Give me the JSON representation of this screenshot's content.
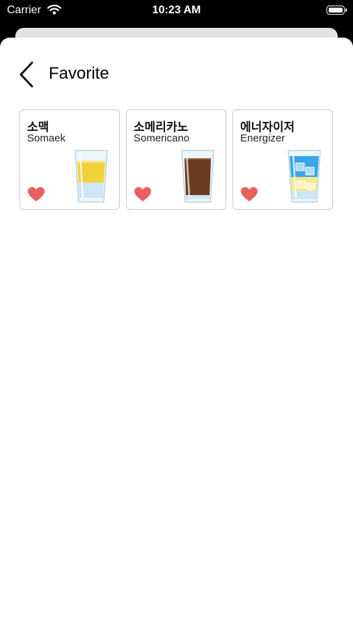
{
  "status_bar": {
    "carrier": "Carrier",
    "time": "10:23 AM",
    "wifi_icon": "wifi-icon",
    "battery_icon": "battery-icon"
  },
  "header": {
    "back_icon": "chevron-left-icon",
    "title": "Favorite"
  },
  "favorites": [
    {
      "name_kr": "소맥",
      "name_en": "Somaek",
      "drink_icon": "beer-glass-icon",
      "colors": {
        "top": "#f2d23a",
        "bottom": "#cfe6f5"
      }
    },
    {
      "name_kr": "소메리카노",
      "name_en": "Somericano",
      "drink_icon": "coffee-glass-icon",
      "colors": {
        "top": "#6a3c22",
        "bottom": "#cfe6f5"
      }
    },
    {
      "name_kr": "에너자이저",
      "name_en": "Energizer",
      "drink_icon": "ice-drink-glass-icon",
      "colors": {
        "top": "#3aa6e8",
        "bottom": "#f3e98a"
      }
    }
  ],
  "colors": {
    "heart": "#e8605f",
    "card_border": "#c9c9c9"
  }
}
